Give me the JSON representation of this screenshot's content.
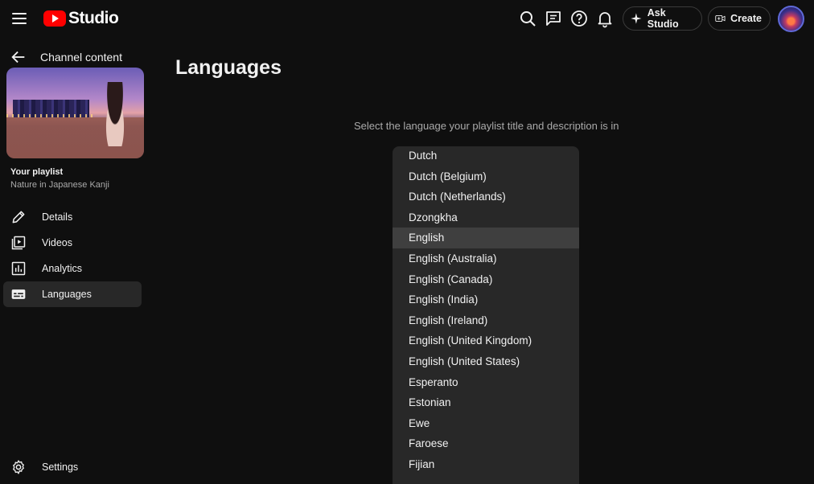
{
  "header": {
    "logo_text": "Studio",
    "ask_studio_label": "Ask Studio",
    "create_label": "Create"
  },
  "sidebar": {
    "back_label": "Channel content",
    "playlist_title": "Your playlist",
    "playlist_name": "Nature in Japanese Kanji",
    "items": [
      {
        "label": "Details",
        "icon": "pencil-icon"
      },
      {
        "label": "Videos",
        "icon": "video-library-icon"
      },
      {
        "label": "Analytics",
        "icon": "analytics-icon"
      },
      {
        "label": "Languages",
        "icon": "subtitles-icon"
      }
    ],
    "settings_label": "Settings"
  },
  "main": {
    "title": "Languages",
    "prompt": "Select the language your playlist title and description is in",
    "languages": [
      "Dutch",
      "Dutch (Belgium)",
      "Dutch (Netherlands)",
      "Dzongkha",
      "English",
      "English (Australia)",
      "English (Canada)",
      "English (India)",
      "English (Ireland)",
      "English (United Kingdom)",
      "English (United States)",
      "Esperanto",
      "Estonian",
      "Ewe",
      "Faroese",
      "Fijian"
    ],
    "highlighted_language": "English"
  },
  "colors": {
    "background": "#0f0f0f",
    "surface": "#282828",
    "highlight": "#3f3f3f",
    "brand_red": "#ff0000"
  }
}
